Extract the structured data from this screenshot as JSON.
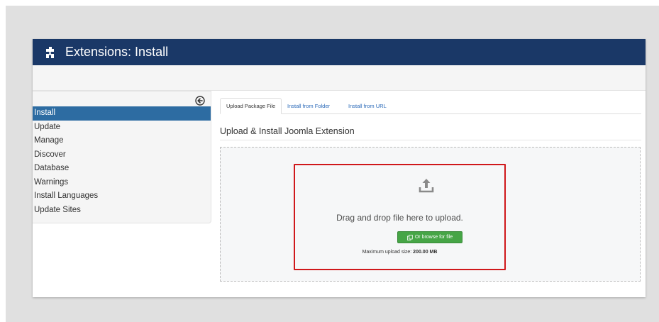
{
  "header": {
    "title": "Extensions: Install",
    "icon": "puzzle-icon",
    "bg": "#1a3867"
  },
  "sidebar": {
    "toggle_icon": "collapse-arrow-icon",
    "items": [
      {
        "label": "Install",
        "active": true
      },
      {
        "label": "Update",
        "active": false
      },
      {
        "label": "Manage",
        "active": false
      },
      {
        "label": "Discover",
        "active": false
      },
      {
        "label": "Database",
        "active": false
      },
      {
        "label": "Warnings",
        "active": false
      },
      {
        "label": "Install Languages",
        "active": false
      },
      {
        "label": "Update Sites",
        "active": false
      }
    ],
    "active_color": "#2d6ca2"
  },
  "tabs": [
    {
      "label": "Upload Package File",
      "active": true
    },
    {
      "label": "Install from Folder",
      "active": false
    },
    {
      "label": "Install from URL",
      "active": false
    }
  ],
  "main": {
    "section_title": "Upload & Install Joomla Extension",
    "upload_icon": "upload-icon",
    "drop_text": "Drag and drop file here to upload.",
    "browse_label": "Or browse for file",
    "browse_icon": "files-icon",
    "max_size_prefix": "Maximum upload size:",
    "max_size_value": "200.00 MB",
    "highlight_color": "#d0181b",
    "button_color": "#46a546"
  }
}
